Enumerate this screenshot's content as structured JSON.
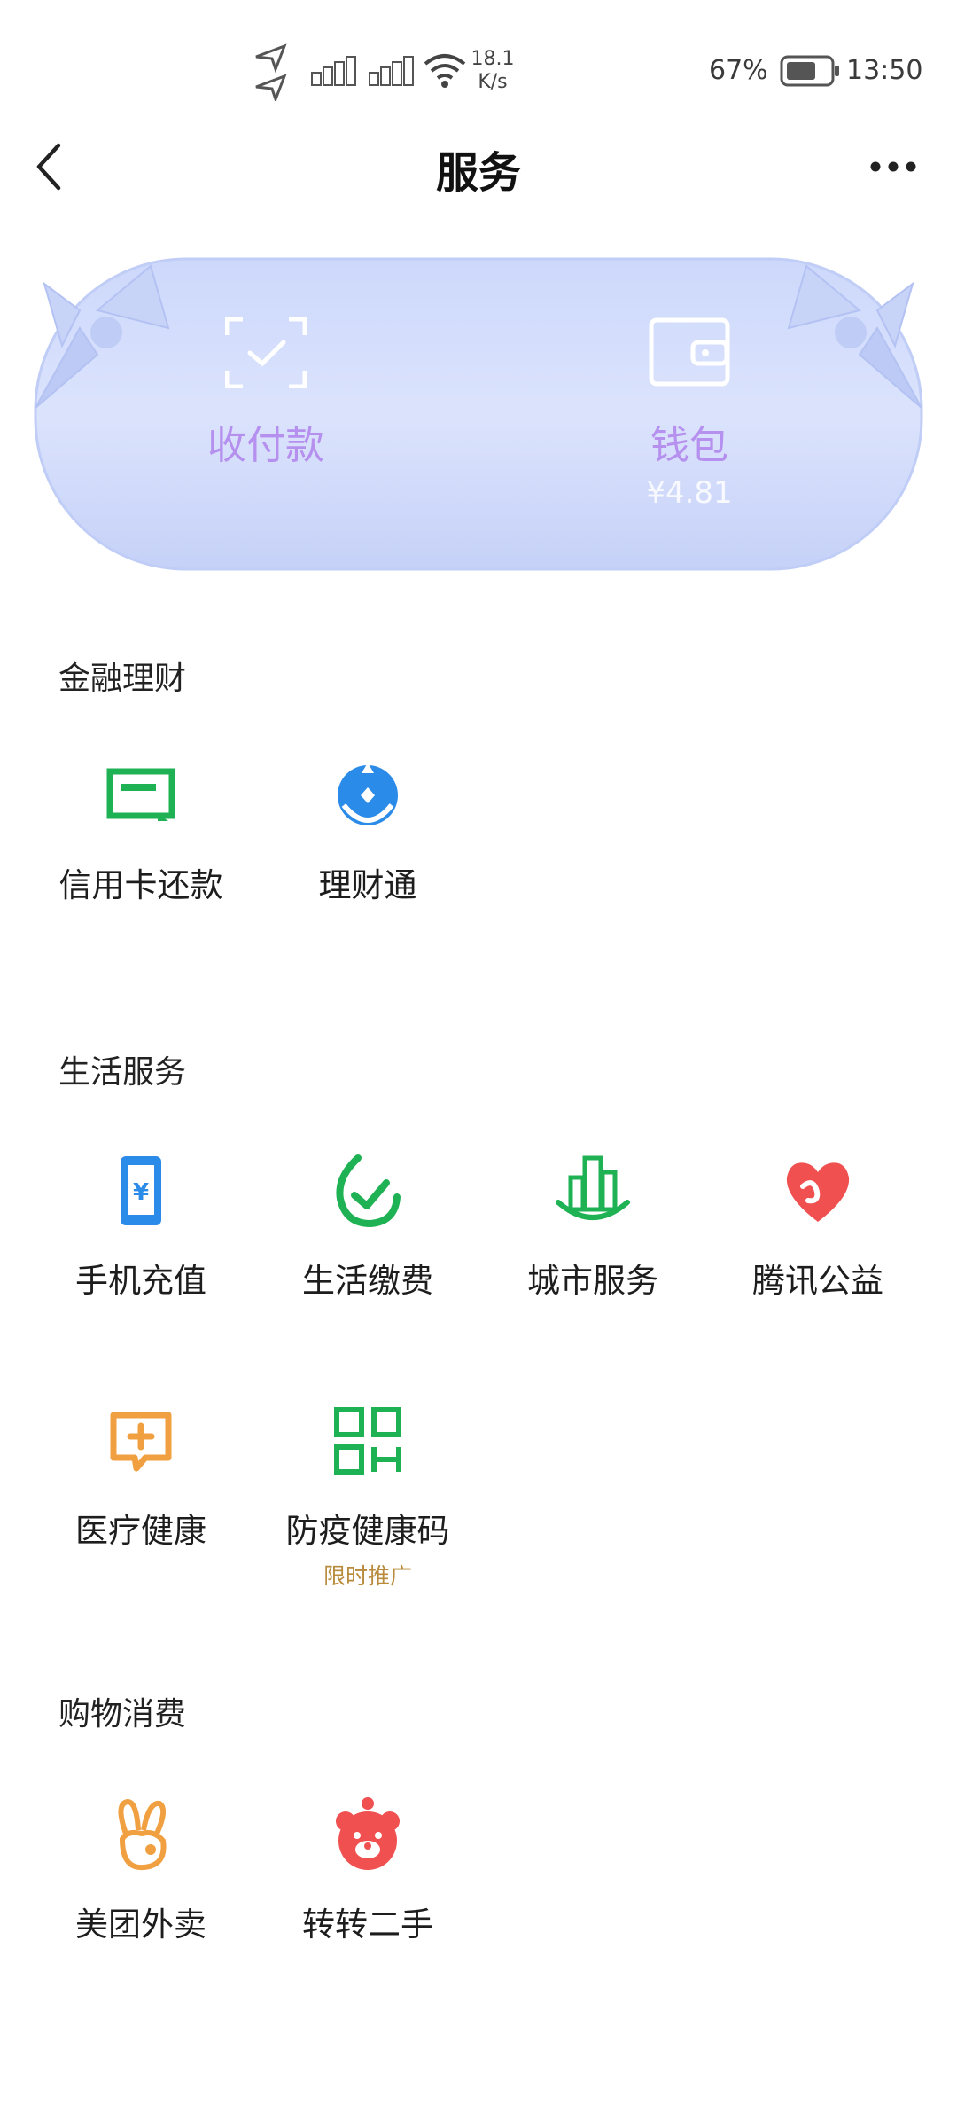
{
  "status_bar": {
    "speed_value": "18.1",
    "speed_unit": "K/s",
    "battery": "67%",
    "time": "13:50"
  },
  "nav": {
    "title": "服务"
  },
  "banner": {
    "pay_label": "收付款",
    "wallet_label": "钱包",
    "wallet_balance": "¥4.81"
  },
  "sections": {
    "finance": {
      "title": "金融理财",
      "items": [
        {
          "label": "信用卡还款",
          "icon": "credit-card-repay-icon"
        },
        {
          "label": "理财通",
          "icon": "licaitong-icon"
        }
      ]
    },
    "life": {
      "title": "生活服务",
      "items": [
        {
          "label": "手机充值",
          "icon": "phone-topup-icon"
        },
        {
          "label": "生活缴费",
          "icon": "utility-payment-icon"
        },
        {
          "label": "城市服务",
          "icon": "city-service-icon"
        },
        {
          "label": "腾讯公益",
          "icon": "charity-heart-icon"
        },
        {
          "label": "医疗健康",
          "icon": "medical-health-icon"
        },
        {
          "label": "防疫健康码",
          "icon": "health-code-icon",
          "tag": "限时推广"
        }
      ]
    },
    "shopping": {
      "title": "购物消费",
      "items": [
        {
          "label": "美团外卖",
          "icon": "meituan-rabbit-icon"
        },
        {
          "label": "转转二手",
          "icon": "zhuanzhuan-bear-icon"
        }
      ]
    }
  },
  "colors": {
    "green": "#1fb255",
    "blue": "#2b8be8",
    "red": "#f05050",
    "orange": "#f0a040",
    "banner_label": "#b690ee"
  }
}
